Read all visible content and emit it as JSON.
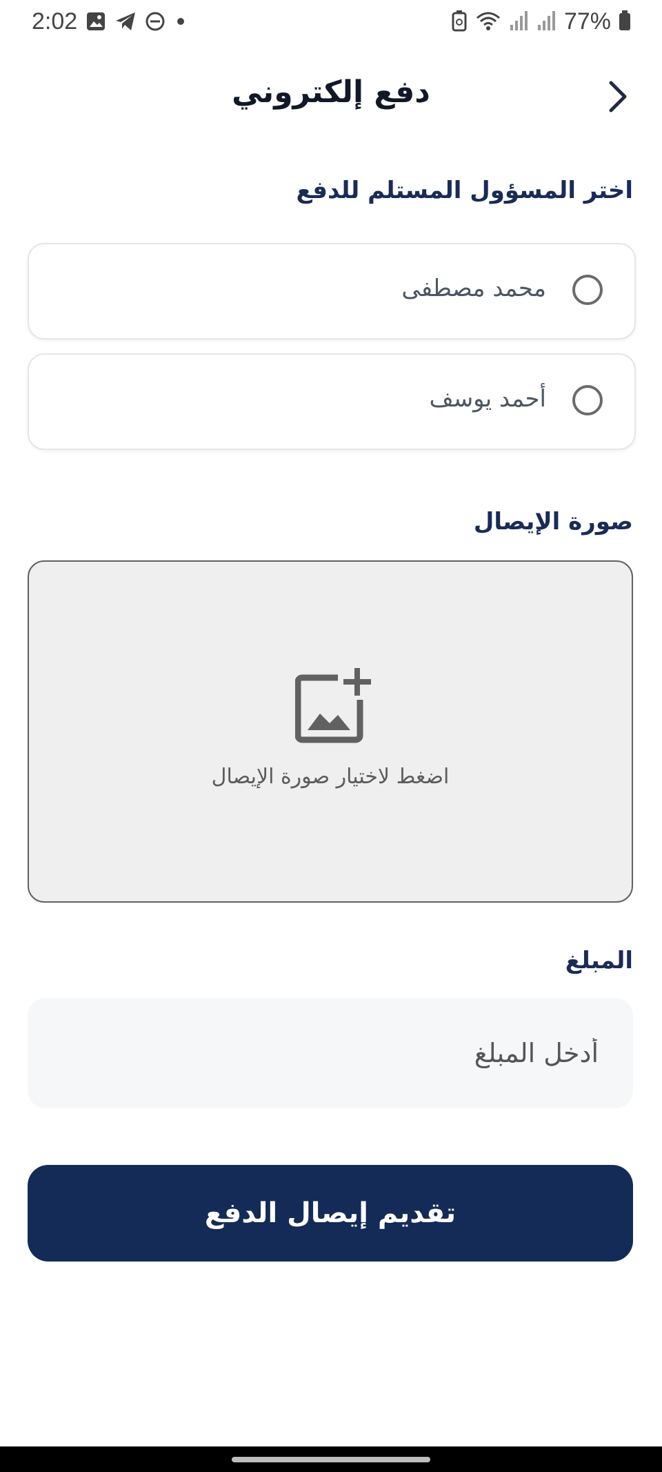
{
  "status_bar": {
    "time": "2:02",
    "battery": "77%",
    "left_icons": [
      "image-icon",
      "telegram-icon",
      "dnd-icon",
      "dot-icon"
    ],
    "right_icons": [
      "battery-saver-icon",
      "wifi-icon",
      "signal-icon",
      "signal-icon",
      "battery-icon"
    ]
  },
  "header": {
    "title": "دفع إلكتروني",
    "back_icon": "chevron-right-icon"
  },
  "recipient_section": {
    "label": "اختر المسؤول المستلم للدفع",
    "options": [
      {
        "label": "محمد مصطفى",
        "selected": false
      },
      {
        "label": "أحمد يوسف",
        "selected": false
      }
    ]
  },
  "receipt_section": {
    "label": "صورة الإيصال",
    "upload_hint": "اضغط لاختيار صورة الإيصال",
    "icon": "add-photo-icon"
  },
  "amount_section": {
    "label": "المبلغ",
    "placeholder": "أدخل المبلغ",
    "value": ""
  },
  "submit": {
    "label": "تقديم إيصال الدفع"
  },
  "colors": {
    "primary": "#132b56",
    "label": "#1a2b56",
    "upload_bg": "#efefef",
    "input_bg": "#f6f7f9"
  }
}
